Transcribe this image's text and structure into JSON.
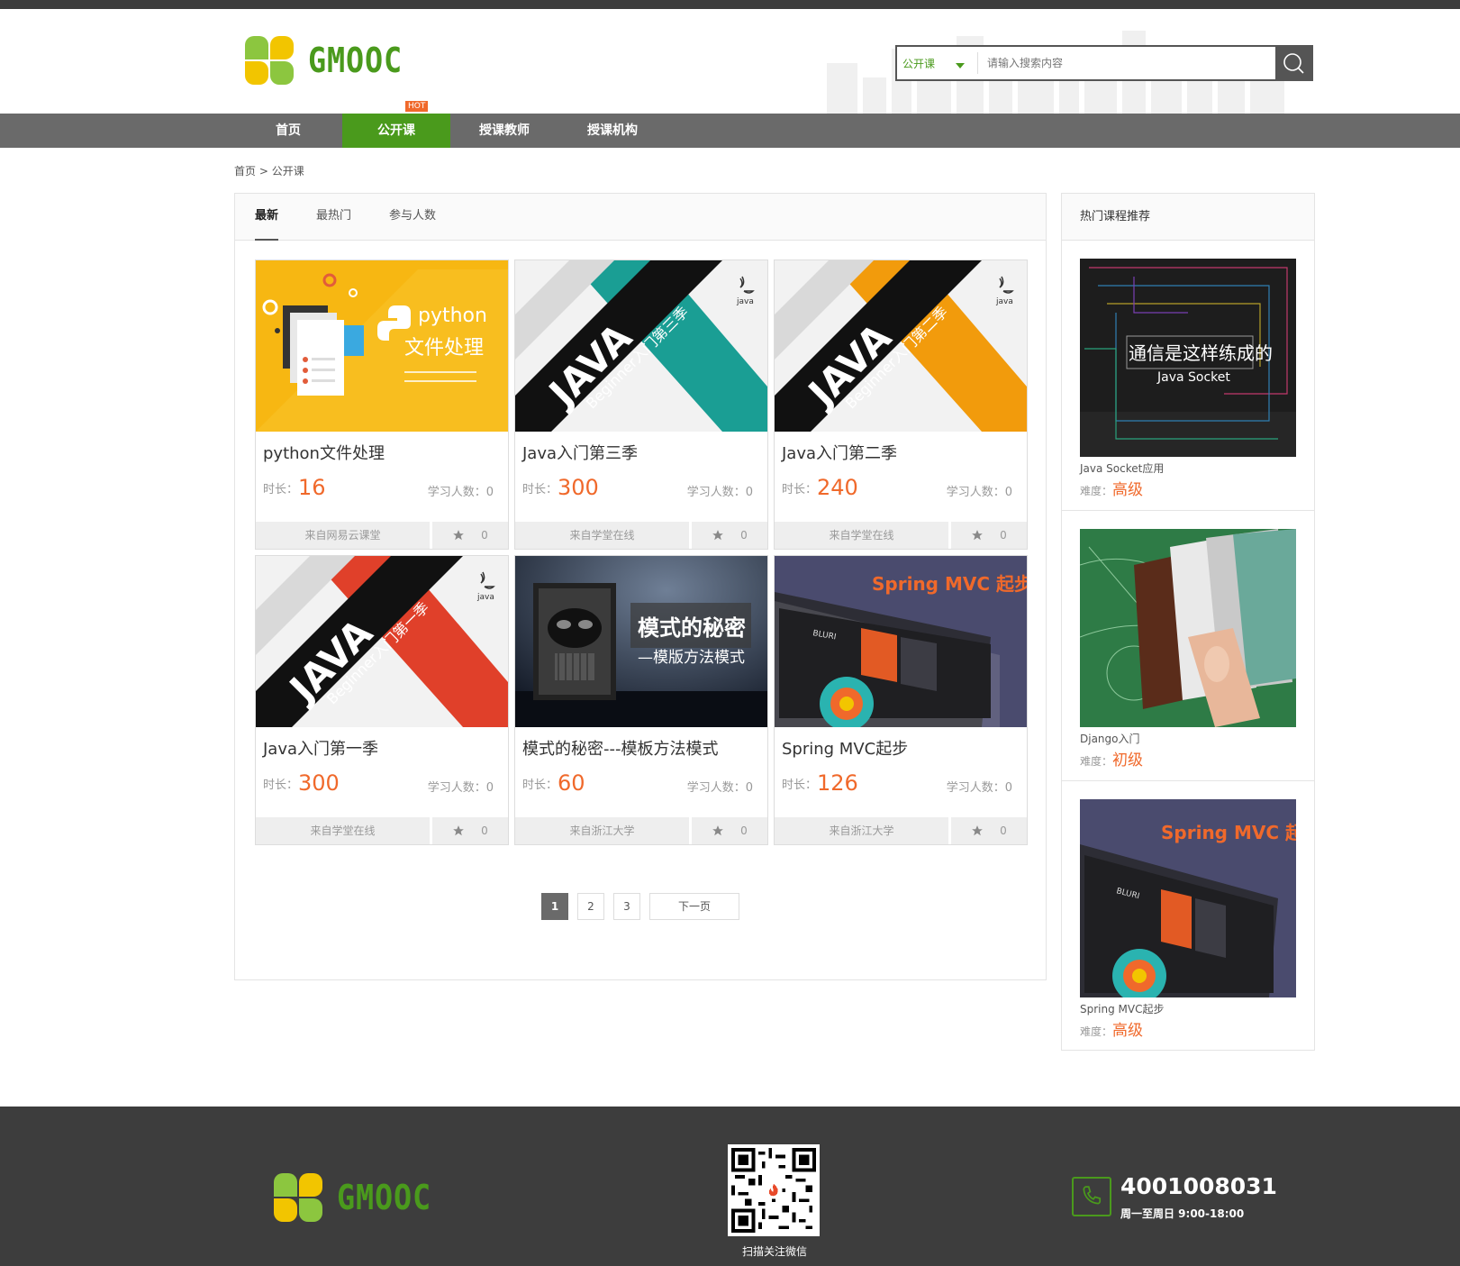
{
  "brand": {
    "name": "GMOOC"
  },
  "search": {
    "type_label": "公开课",
    "placeholder": "请输入搜索内容"
  },
  "nav": {
    "items": [
      {
        "label": "首页"
      },
      {
        "label": "公开课",
        "badge": "HOT"
      },
      {
        "label": "授课教师"
      },
      {
        "label": "授课机构"
      }
    ]
  },
  "breadcrumb": {
    "home": "首页",
    "sep": ">",
    "current": "公开课"
  },
  "tabs": [
    {
      "label": "最新"
    },
    {
      "label": "最热门"
    },
    {
      "label": "参与人数"
    }
  ],
  "course_labels": {
    "duration": "时长：",
    "students": "学习人数："
  },
  "courses": [
    {
      "title": "python文件处理",
      "duration": "16",
      "students": "0",
      "source": "来自网易云课堂",
      "favs": "0",
      "cover": "python"
    },
    {
      "title": "Java入门第三季",
      "duration": "300",
      "students": "0",
      "source": "来自学堂在线",
      "favs": "0",
      "cover": "java3"
    },
    {
      "title": "Java入门第二季",
      "duration": "240",
      "students": "0",
      "source": "来自学堂在线",
      "favs": "0",
      "cover": "java2"
    },
    {
      "title": "Java入门第一季",
      "duration": "300",
      "students": "0",
      "source": "来自学堂在线",
      "favs": "0",
      "cover": "java1"
    },
    {
      "title": "模式的秘密---模板方法模式",
      "duration": "60",
      "students": "0",
      "source": "来自浙江大学",
      "favs": "0",
      "cover": "pattern"
    },
    {
      "title": "Spring MVC起步",
      "duration": "126",
      "students": "0",
      "source": "来自浙江大学",
      "favs": "0",
      "cover": "spring"
    }
  ],
  "cover_text": {
    "python": {
      "lang": "python",
      "sub": "文件处理"
    },
    "java": {
      "word": "JAVA",
      "logo": "java"
    },
    "java3": {
      "sub": "Beginner入门第三季"
    },
    "java2": {
      "sub": "Beginner入门第二季"
    },
    "java1": {
      "sub": "Beginner入门第一季"
    },
    "pattern": {
      "title": "模式的秘密",
      "sub": "—模版方法模式"
    },
    "spring": {
      "title": "Spring MVC 起步",
      "browser": "BLURI"
    },
    "socket": {
      "title": "通信是这样练成的",
      "sub": "Java Socket"
    }
  },
  "pagination": {
    "pages": [
      "1",
      "2",
      "3"
    ],
    "current": "1",
    "next": "下一页"
  },
  "sidebar": {
    "title": "热门课程推荐",
    "level_label": "难度：",
    "items": [
      {
        "name": "Java Socket应用",
        "level": "高级",
        "cover": "socket"
      },
      {
        "name": "Django入门",
        "level": "初级",
        "cover": "django"
      },
      {
        "name": "Spring MVC起步",
        "level": "高级",
        "cover": "spring"
      }
    ]
  },
  "footer": {
    "qr_caption": "扫描关注微信",
    "phone": "4001008031",
    "hours": "周一至周日 9:00-18:00"
  },
  "colors": {
    "brand_green": "#4a9a1c",
    "accent_orange": "#f0692b",
    "nav_gray": "#6a6a6a",
    "footer_dark": "#3d3d3d"
  }
}
